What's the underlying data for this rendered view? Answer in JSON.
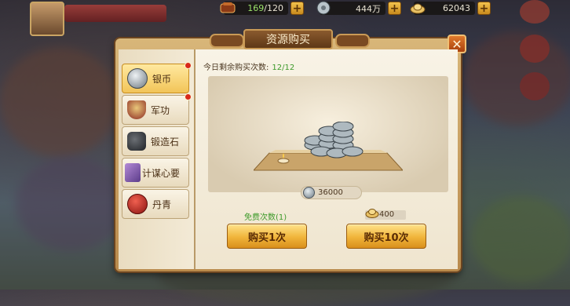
{
  "resources": [
    {
      "icon": "ration-icon",
      "value": "169",
      "max": "/120"
    },
    {
      "icon": "silver-coin-icon",
      "value": "444万"
    },
    {
      "icon": "gold-ingot-icon",
      "value": "62043"
    }
  ],
  "dialog": {
    "title": "资源购买",
    "close_label": "✕",
    "tabs": [
      {
        "label": "银币",
        "icon": "silver-coin-icon",
        "active": true,
        "dot": true
      },
      {
        "label": "军功",
        "icon": "military-merit-icon",
        "active": false,
        "dot": true
      },
      {
        "label": "锻造石",
        "icon": "forging-stone-icon",
        "active": false,
        "dot": false
      },
      {
        "label": "计谋心要",
        "icon": "strategy-book-icon",
        "active": false,
        "dot": false
      },
      {
        "label": "丹青",
        "icon": "red-pill-icon",
        "active": false,
        "dot": false
      }
    ],
    "remaining_label": "今日剩余购买次数:",
    "remaining_value": "12/12",
    "reward_amount": "36000",
    "free_label": "免费次数(1)",
    "ten_cost": "400",
    "buy_one_label": "购买1次",
    "buy_ten_label": "购买10次"
  },
  "colors": {
    "accent_green": "#3d9a2a",
    "button_gold": "#f0b43a",
    "close_orange": "#e07a2c"
  }
}
